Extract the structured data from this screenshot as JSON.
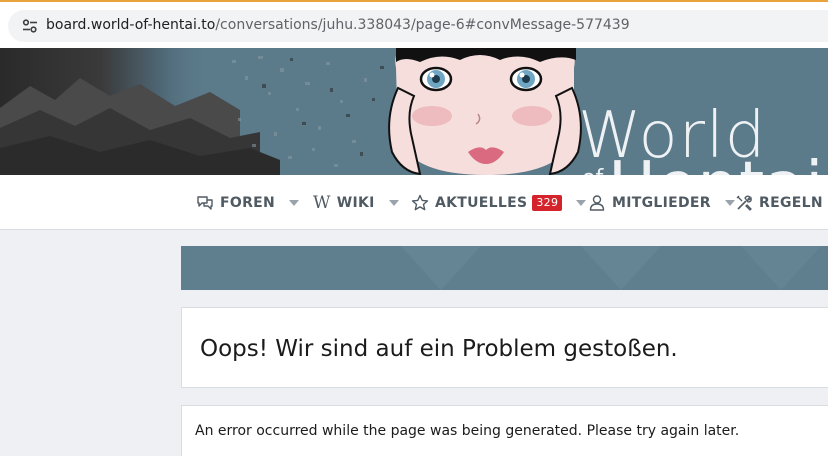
{
  "browser": {
    "url_host": "board.world-of-hentai.to",
    "url_path": "/conversations/juhu.338043/page-6#convMessage-577439",
    "site_info_icon": "tune-icon"
  },
  "banner": {
    "logo_line1": "World",
    "logo_of": "of",
    "logo_line2": "Hentai"
  },
  "nav": {
    "items": [
      {
        "label": "FOREN",
        "icon": "comments-icon"
      },
      {
        "label": "WIKI",
        "icon": "wikipedia-w-icon",
        "glyph": "W"
      },
      {
        "label": "AKTUELLES",
        "icon": "star-icon",
        "badge": "329"
      },
      {
        "label": "MITGLIEDER",
        "icon": "user-icon"
      },
      {
        "label": "REGELN",
        "icon": "tools-icon"
      }
    ],
    "badge_color": "#d4232b"
  },
  "error": {
    "title": "Oops! Wir sind auf ein Problem gestoßen.",
    "message": "An error occurred while the page was being generated. Please try again later."
  },
  "colors": {
    "accent": "#5b7a8a",
    "nav_text": "#505a63",
    "page_bg": "#eef0f3"
  }
}
